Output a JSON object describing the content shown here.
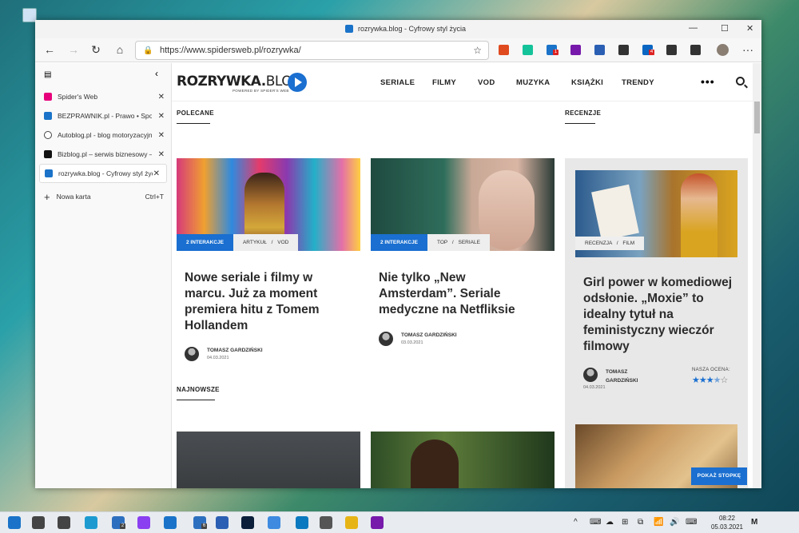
{
  "window": {
    "title": "rozrywka.blog - Cyfrowy styl życia",
    "controls": {
      "minimize": "—",
      "maximize": "☐",
      "close": "✕"
    }
  },
  "toolbar": {
    "url": "https://www.spidersweb.pl/rozrywka/",
    "back": "←",
    "forward": "→",
    "refresh": "↻",
    "home": "⌂",
    "menu": "···",
    "extensions": [
      {
        "name": "office-extension-icon",
        "color": "#e04a1f",
        "badge": ""
      },
      {
        "name": "grammarly-extension-icon",
        "color": "#15c39a",
        "badge": ""
      },
      {
        "name": "notification-extension-icon",
        "color": "#1a73c8",
        "badge": "1"
      },
      {
        "name": "onenote-extension-icon",
        "color": "#7719aa",
        "badge": ""
      },
      {
        "name": "quill-extension-icon",
        "color": "#2b5fb3",
        "badge": ""
      },
      {
        "name": "share-extension-icon",
        "color": "#333333",
        "badge": ""
      },
      {
        "name": "linkedin-extension-icon",
        "color": "#0a66c2",
        "badge": "4"
      },
      {
        "name": "collections-icon",
        "color": "#333333",
        "badge": ""
      },
      {
        "name": "share-icon",
        "color": "#333333",
        "badge": ""
      }
    ]
  },
  "sidebar": {
    "tabs": [
      {
        "label": "Spider's Web",
        "icon": "pink"
      },
      {
        "label": "BEZPRAWNIK.pl - Prawo • Społeczeństwo",
        "icon": "hg"
      },
      {
        "label": "Autoblog.pl - blog motoryzacyjny",
        "icon": "ab"
      },
      {
        "label": "Bizblog.pl – serwis biznesowy – polityka",
        "icon": "bz"
      },
      {
        "label": "rozrywka.blog - Cyfrowy styl życia",
        "icon": "blue"
      }
    ],
    "new_tab": {
      "label": "Nowa karta",
      "shortcut": "Ctrl+T"
    }
  },
  "site": {
    "logo_main": "ROZRYWKA.",
    "logo_blog": "BLOG",
    "logo_sub": "POWERED BY SPIDER'S WEB",
    "nav": [
      "SERIALE",
      "FILMY",
      "VOD",
      "MUZYKA",
      "KSIĄŻKI",
      "TRENDY"
    ],
    "more": "•••"
  },
  "sections": {
    "featured": "POLECANE",
    "reviews": "RECENZJE",
    "newest": "NAJNOWSZE"
  },
  "articles": [
    {
      "interactions": "2 INTERAKCJE",
      "categories": "ARTYKUŁ / VOD",
      "title": "Nowe seriale i filmy w marcu. Już za moment premiera hitu z Tomem Hollandem",
      "author": "TOMASZ GARDZIŃSKI",
      "date": "04.03.2021"
    },
    {
      "interactions": "2 INTERAKCJE",
      "categories": "TOP / SERIALE",
      "title": "Nie tylko „New Amsterdam”. Seriale medyczne na Netfliksie",
      "author": "TOMASZ GARDZIŃSKI",
      "date": "03.03.2021"
    }
  ],
  "review": {
    "categories": "RECENZJA / FILM",
    "title": "Girl power w komediowej odsłonie. „Moxie” to idealny tytuł na feministyczny wieczór filmowy",
    "author": "TOMASZ GARDZIŃSKI",
    "date": "04.03.2021",
    "rating_label": "NASZA OCENA:",
    "rating": 3.5,
    "rating_max": 5
  },
  "footer_button": "POKAŻ STOPKĘ",
  "taskbar": {
    "time": "08:22",
    "date": "05.03.2021",
    "apps": [
      {
        "name": "start-icon",
        "color": "#1a73c8",
        "badge": ""
      },
      {
        "name": "search-icon",
        "color": "#444444",
        "badge": ""
      },
      {
        "name": "task-view-icon",
        "color": "#444444",
        "badge": ""
      },
      {
        "name": "edge-icon",
        "color": "#1d9bd1",
        "badge": ""
      },
      {
        "name": "mail-icon",
        "color": "#2d6fbf",
        "badge": "2"
      },
      {
        "name": "messenger-icon",
        "color": "#8a3ff0",
        "badge": ""
      },
      {
        "name": "edge-dev-icon",
        "color": "#1a73c8",
        "badge": ""
      },
      {
        "name": "files-icon",
        "color": "#2d6fbf",
        "badge": "6"
      },
      {
        "name": "word-icon",
        "color": "#2b5fb3",
        "badge": ""
      },
      {
        "name": "photoshop-icon",
        "color": "#0b1e3a",
        "badge": ""
      },
      {
        "name": "chrome-icon",
        "color": "#3d8ae0",
        "badge": ""
      },
      {
        "name": "trello-icon",
        "color": "#0b79bf",
        "badge": ""
      },
      {
        "name": "calculator-icon",
        "color": "#555555",
        "badge": ""
      },
      {
        "name": "explorer-icon",
        "color": "#e7b416",
        "badge": ""
      },
      {
        "name": "onenote-icon",
        "color": "#7719aa",
        "badge": ""
      }
    ],
    "tray": [
      "^",
      "⌨",
      "☁",
      "⊞",
      "⧉",
      "📶",
      "🔊",
      "⌨"
    ],
    "notifications": "M"
  }
}
